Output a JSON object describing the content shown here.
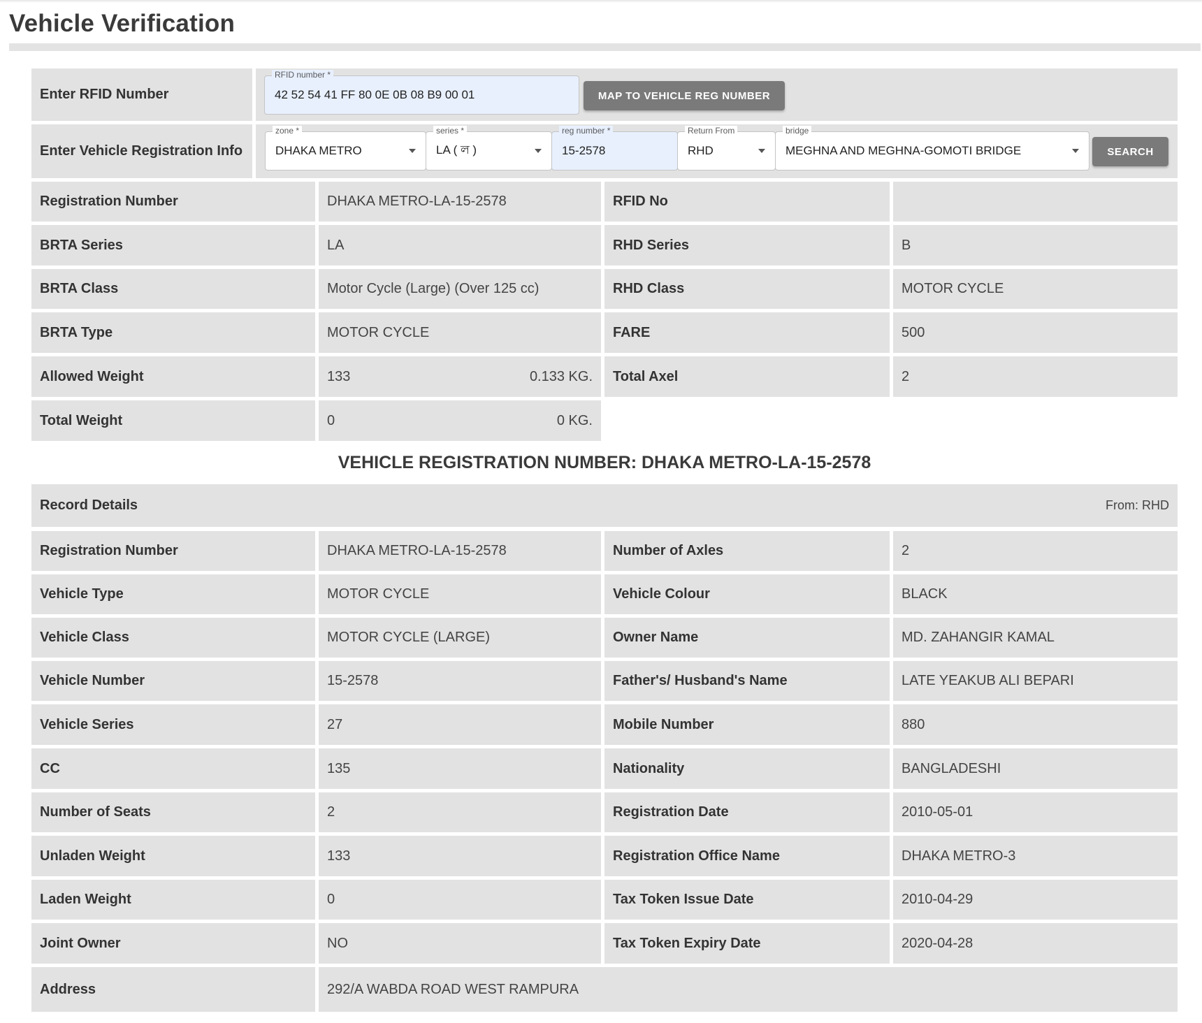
{
  "page": {
    "title": "Vehicle Verification"
  },
  "rfid_section": {
    "label": "Enter RFID Number",
    "rfid_field": {
      "label": "RFID number *",
      "value": "42 52 54 41 FF 80 0E 0B 08 B9 00 01"
    },
    "map_button": "MAP TO VEHICLE REG NUMBER"
  },
  "reg_section": {
    "label": "Enter Vehicle Registration Info",
    "zone": {
      "label": "zone *",
      "value": "DHAKA METRO"
    },
    "series": {
      "label": "series *",
      "value": "LA ( ল )"
    },
    "reg_number": {
      "label": "reg number *",
      "value": "15-2578"
    },
    "return_from": {
      "label": "Return From",
      "value": "RHD"
    },
    "bridge": {
      "label": "bridge",
      "value": "MEGHNA AND MEGHNA-GOMOTI BRIDGE"
    },
    "search_button": "SEARCH"
  },
  "summary": [
    {
      "l1": "Registration Number",
      "v1": "DHAKA METRO-LA-15-2578",
      "l2": "RFID No",
      "v2": ""
    },
    {
      "l1": "BRTA Series",
      "v1": "LA",
      "l2": "RHD Series",
      "v2": "B"
    },
    {
      "l1": "BRTA Class",
      "v1": "Motor Cycle (Large) (Over 125 cc)",
      "l2": "RHD Class",
      "v2": "MOTOR CYCLE"
    },
    {
      "l1": "BRTA Type",
      "v1": "MOTOR CYCLE",
      "l2": "FARE",
      "v2": "500"
    }
  ],
  "weights": {
    "allowed": {
      "label": "Allowed Weight",
      "value": "133",
      "kg": "0.133 KG."
    },
    "total_axel": {
      "label": "Total Axel",
      "value": "2"
    },
    "total": {
      "label": "Total Weight",
      "value": "0",
      "kg": "0 KG."
    }
  },
  "vehicle_heading": "VEHICLE REGISTRATION NUMBER: DHAKA METRO-LA-15-2578",
  "record": {
    "title": "Record Details",
    "from": "From: RHD",
    "rows": [
      {
        "l1": "Registration Number",
        "v1": "DHAKA METRO-LA-15-2578",
        "l2": "Number of Axles",
        "v2": "2"
      },
      {
        "l1": "Vehicle Type",
        "v1": "MOTOR CYCLE",
        "l2": "Vehicle Colour",
        "v2": "BLACK"
      },
      {
        "l1": "Vehicle Class",
        "v1": "MOTOR CYCLE (LARGE)",
        "l2": "Owner Name",
        "v2": "MD. ZAHANGIR KAMAL"
      },
      {
        "l1": "Vehicle Number",
        "v1": "15-2578",
        "l2": "Father's/ Husband's Name",
        "v2": "LATE YEAKUB ALI BEPARI"
      },
      {
        "l1": "Vehicle Series",
        "v1": "27",
        "l2": "Mobile Number",
        "v2": "880"
      },
      {
        "l1": "CC",
        "v1": "135",
        "l2": "Nationality",
        "v2": "BANGLADESHI"
      },
      {
        "l1": "Number of Seats",
        "v1": "2",
        "l2": "Registration Date",
        "v2": "2010-05-01"
      },
      {
        "l1": "Unladen Weight",
        "v1": "133",
        "l2": "Registration Office Name",
        "v2": "DHAKA METRO-3"
      },
      {
        "l1": "Laden Weight",
        "v1": "0",
        "l2": "Tax Token Issue Date",
        "v2": "2010-04-29"
      },
      {
        "l1": "Joint Owner",
        "v1": "NO",
        "l2": "Tax Token Expiry Date",
        "v2": "2020-04-28"
      }
    ],
    "address": {
      "label": "Address",
      "value": "292/A WABDA ROAD WEST RAMPURA"
    }
  }
}
